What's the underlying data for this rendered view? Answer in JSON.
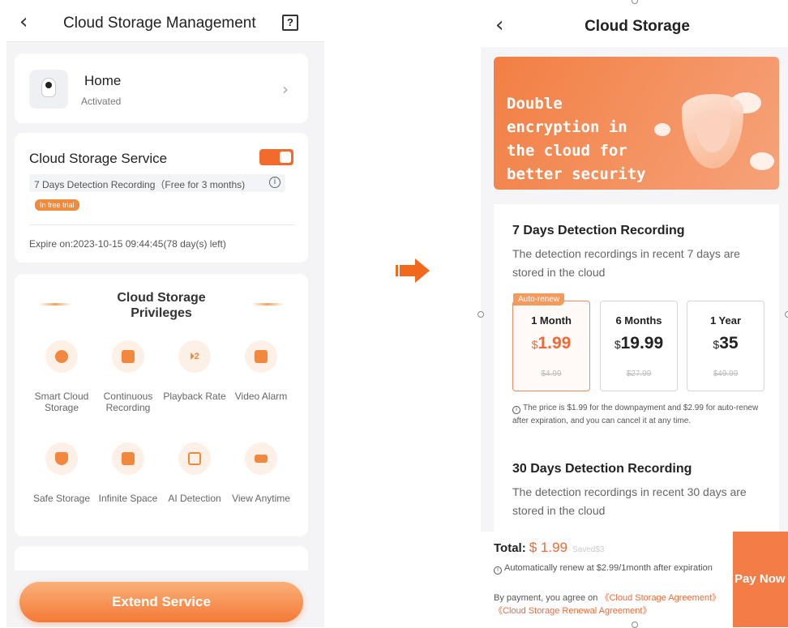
{
  "left": {
    "header": {
      "back_icon": "chevron-left-icon",
      "title": "Cloud Storage Management",
      "help_label": "?"
    },
    "device": {
      "name": "Home",
      "status": "Activated",
      "chevron": "›"
    },
    "service": {
      "title": "Cloud Storage Service",
      "toggle_on": true,
      "plan": "7 Days Detection Recording（Free for 3 months)",
      "info": "i",
      "trial_badge": "In free trial",
      "expire": "Expire on:2023-10-15 09:44:45(78 day(s) left)"
    },
    "privileges": {
      "title": "Cloud Storage Privileges",
      "items": [
        {
          "label": "Smart Cloud Storage",
          "icon": "cloud-icon"
        },
        {
          "label": "Continuous Recording",
          "icon": "video-camera-icon"
        },
        {
          "label": "Playback Rate",
          "icon": "speed-icon",
          "glyph": "⏵2"
        },
        {
          "label": "Video Alarm",
          "icon": "video-alarm-icon"
        },
        {
          "label": "Safe Storage",
          "icon": "shield-icon"
        },
        {
          "label": "Infinite Space",
          "icon": "box-icon"
        },
        {
          "label": "AI Detection",
          "icon": "face-scan-icon"
        },
        {
          "label": "View Anytime",
          "icon": "camera-view-icon"
        }
      ]
    },
    "extend_button": "Extend Service"
  },
  "right": {
    "header": {
      "back_icon": "chevron-left-icon",
      "title": "Cloud Storage"
    },
    "banner": {
      "text": "Double encryption in the cloud for better security"
    },
    "plan1": {
      "title": "7 Days Detection Recording",
      "desc": "The detection recordings in recent 7 days are stored in the cloud",
      "options": [
        {
          "name": "1 Month",
          "currency": "$",
          "price": "1.99",
          "original": "$4.99",
          "badge": "Auto-renew",
          "selected": true
        },
        {
          "name": "6 Months",
          "currency": "$",
          "price": "19.99",
          "original": "$27.99",
          "selected": false
        },
        {
          "name": "1 Year",
          "currency": "$",
          "price": "35",
          "original": "$49.99",
          "selected": false
        }
      ],
      "note": "The price is $1.99 for the downpayment and $2.99 for auto-renew after expiration, and you can cancel it at any time."
    },
    "plan2": {
      "title": "30 Days Detection Recording",
      "desc": "The detection recordings in recent 30 days are stored in the cloud"
    },
    "footer": {
      "total_label": "Total:",
      "total_amount": "$ 1.99",
      "saved": "Saved$3",
      "auto_note": "Automatically renew at $2.99/1month after expiration",
      "agree_prefix": "By payment, you agree on ",
      "link1": "《Cloud Storage Agreement》",
      "link2": "《Cloud Storage Renewal Agreement》",
      "pay_button": "Pay Now"
    }
  },
  "colors": {
    "accent": "#f26b2c",
    "accent_light": "#fdf0e6",
    "price": "#ef6a37",
    "arrow": "#f2681d"
  }
}
